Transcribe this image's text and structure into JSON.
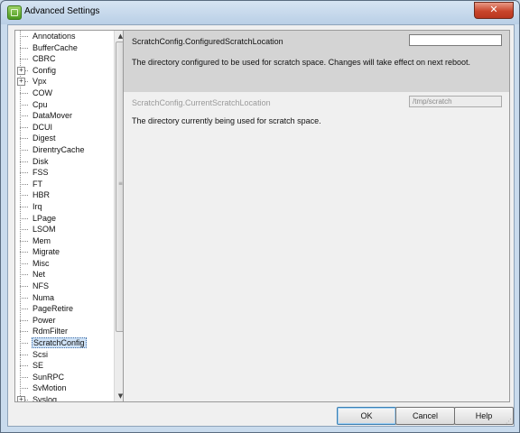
{
  "window": {
    "title": "Advanced Settings",
    "close_label": "✕"
  },
  "tree": {
    "items": [
      {
        "label": "Annotations",
        "expandable": false
      },
      {
        "label": "BufferCache",
        "expandable": false
      },
      {
        "label": "CBRC",
        "expandable": false
      },
      {
        "label": "Config",
        "expandable": true
      },
      {
        "label": "Vpx",
        "expandable": true
      },
      {
        "label": "COW",
        "expandable": false
      },
      {
        "label": "Cpu",
        "expandable": false
      },
      {
        "label": "DataMover",
        "expandable": false
      },
      {
        "label": "DCUI",
        "expandable": false
      },
      {
        "label": "Digest",
        "expandable": false
      },
      {
        "label": "DirentryCache",
        "expandable": false
      },
      {
        "label": "Disk",
        "expandable": false
      },
      {
        "label": "FSS",
        "expandable": false
      },
      {
        "label": "FT",
        "expandable": false
      },
      {
        "label": "HBR",
        "expandable": false
      },
      {
        "label": "Irq",
        "expandable": false
      },
      {
        "label": "LPage",
        "expandable": false
      },
      {
        "label": "LSOM",
        "expandable": false
      },
      {
        "label": "Mem",
        "expandable": false
      },
      {
        "label": "Migrate",
        "expandable": false
      },
      {
        "label": "Misc",
        "expandable": false
      },
      {
        "label": "Net",
        "expandable": false
      },
      {
        "label": "NFS",
        "expandable": false
      },
      {
        "label": "Numa",
        "expandable": false
      },
      {
        "label": "PageRetire",
        "expandable": false
      },
      {
        "label": "Power",
        "expandable": false
      },
      {
        "label": "RdmFilter",
        "expandable": false
      },
      {
        "label": "ScratchConfig",
        "expandable": false,
        "selected": true
      },
      {
        "label": "Scsi",
        "expandable": false
      },
      {
        "label": "SE",
        "expandable": false
      },
      {
        "label": "SunRPC",
        "expandable": false
      },
      {
        "label": "SvMotion",
        "expandable": false
      },
      {
        "label": "Syslog",
        "expandable": true
      }
    ]
  },
  "settings": [
    {
      "name": "ScratchConfig.ConfiguredScratchLocation",
      "value": "",
      "description": "The directory configured to be used for scratch space. Changes will take effect on next reboot.",
      "editable": true
    },
    {
      "name": "ScratchConfig.CurrentScratchLocation",
      "value": "/tmp/scratch",
      "description": "The directory currently being used for scratch space.",
      "editable": false
    }
  ],
  "buttons": {
    "ok": "OK",
    "cancel": "Cancel",
    "help": "Help"
  }
}
